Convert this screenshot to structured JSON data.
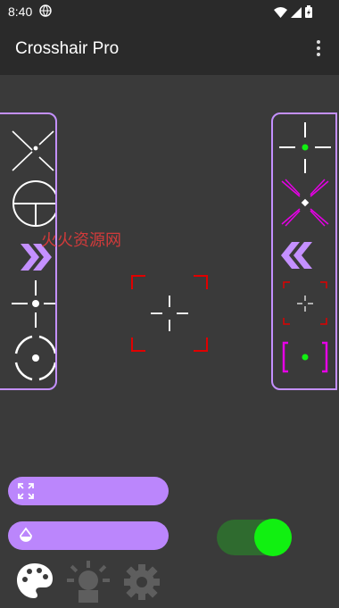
{
  "status": {
    "time": "8:40",
    "icons": [
      "globe-icon",
      "wifi-icon",
      "cell-signal-icon",
      "battery-charging-icon"
    ]
  },
  "appbar": {
    "title": "Crosshair Pro",
    "menu_icon": "more-vert-icon"
  },
  "watermark": "火火资源网",
  "left_panel": {
    "items": [
      "x-crosshair-icon",
      "scope-crosshair-icon",
      "next-arrow-icon",
      "dot-cross-crosshair-icon",
      "circle-dot-crosshair-icon"
    ]
  },
  "right_panel": {
    "items": [
      "green-dot-cross-crosshair-icon",
      "magenta-x-crosshair-icon",
      "prev-arrow-icon",
      "red-bracket-crosshair-icon",
      "magenta-bracket-crosshair-icon"
    ]
  },
  "controls": {
    "size_slider_icon": "expand-icon",
    "opacity_slider_icon": "opacity-drop-icon",
    "toggle_on": true
  },
  "bottom_tabs": [
    "palette-icon",
    "brightness-icon",
    "settings-icon"
  ],
  "colors": {
    "accent": "#bb86fc",
    "toggle_thumb": "#11f011",
    "toggle_track": "#2f6b2f",
    "background": "#3a3a3a",
    "bar": "#2a2a2a"
  }
}
